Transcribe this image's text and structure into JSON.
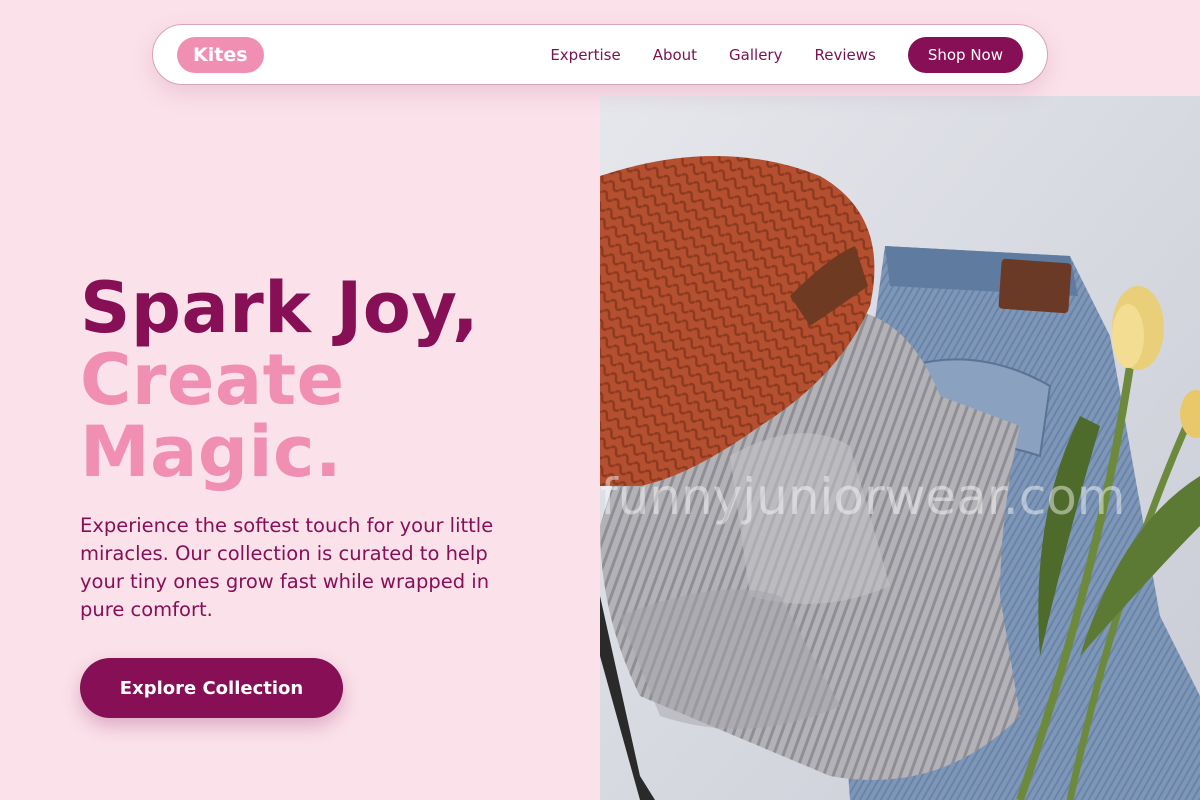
{
  "nav": {
    "logo": "Kites",
    "links": [
      "Expertise",
      "About",
      "Gallery",
      "Reviews"
    ],
    "cta": "Shop Now"
  },
  "hero": {
    "title_line1": "Spark Joy,",
    "title_line2": "Create",
    "title_line3": "Magic.",
    "description": "Experience the softest touch for your little miracles. Our collection is curated to help your tiny ones grow fast while wrapped in pure comfort.",
    "button": "Explore Collection"
  },
  "image": {
    "alt": "Flat lay of knit beanie, grey sweater, denim jeans and yellow tulips",
    "watermark": "funnyjuniorwear.com"
  },
  "colors": {
    "background": "#fbe1ea",
    "primary": "#870f55",
    "accent_pink": "#f08fb1",
    "white": "#ffffff"
  }
}
